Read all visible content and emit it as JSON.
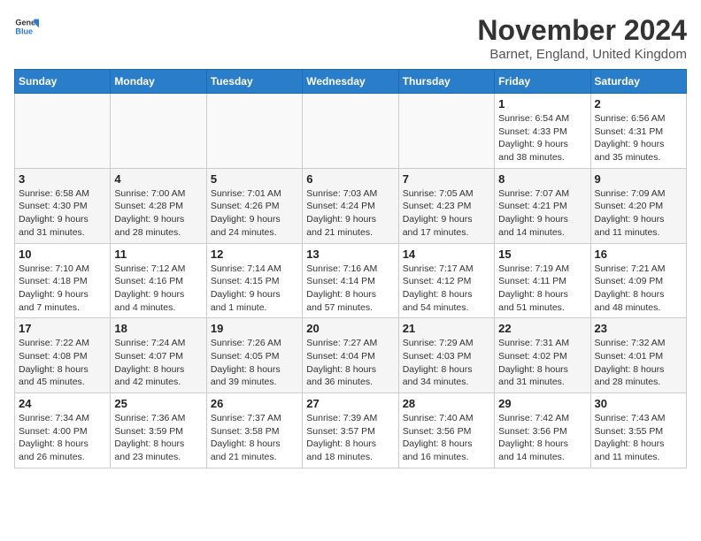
{
  "logo": {
    "text_general": "General",
    "text_blue": "Blue"
  },
  "title": "November 2024",
  "subtitle": "Barnet, England, United Kingdom",
  "days_of_week": [
    "Sunday",
    "Monday",
    "Tuesday",
    "Wednesday",
    "Thursday",
    "Friday",
    "Saturday"
  ],
  "weeks": [
    [
      {
        "day": "",
        "info": ""
      },
      {
        "day": "",
        "info": ""
      },
      {
        "day": "",
        "info": ""
      },
      {
        "day": "",
        "info": ""
      },
      {
        "day": "",
        "info": ""
      },
      {
        "day": "1",
        "info": "Sunrise: 6:54 AM\nSunset: 4:33 PM\nDaylight: 9 hours\nand 38 minutes."
      },
      {
        "day": "2",
        "info": "Sunrise: 6:56 AM\nSunset: 4:31 PM\nDaylight: 9 hours\nand 35 minutes."
      }
    ],
    [
      {
        "day": "3",
        "info": "Sunrise: 6:58 AM\nSunset: 4:30 PM\nDaylight: 9 hours\nand 31 minutes."
      },
      {
        "day": "4",
        "info": "Sunrise: 7:00 AM\nSunset: 4:28 PM\nDaylight: 9 hours\nand 28 minutes."
      },
      {
        "day": "5",
        "info": "Sunrise: 7:01 AM\nSunset: 4:26 PM\nDaylight: 9 hours\nand 24 minutes."
      },
      {
        "day": "6",
        "info": "Sunrise: 7:03 AM\nSunset: 4:24 PM\nDaylight: 9 hours\nand 21 minutes."
      },
      {
        "day": "7",
        "info": "Sunrise: 7:05 AM\nSunset: 4:23 PM\nDaylight: 9 hours\nand 17 minutes."
      },
      {
        "day": "8",
        "info": "Sunrise: 7:07 AM\nSunset: 4:21 PM\nDaylight: 9 hours\nand 14 minutes."
      },
      {
        "day": "9",
        "info": "Sunrise: 7:09 AM\nSunset: 4:20 PM\nDaylight: 9 hours\nand 11 minutes."
      }
    ],
    [
      {
        "day": "10",
        "info": "Sunrise: 7:10 AM\nSunset: 4:18 PM\nDaylight: 9 hours\nand 7 minutes."
      },
      {
        "day": "11",
        "info": "Sunrise: 7:12 AM\nSunset: 4:16 PM\nDaylight: 9 hours\nand 4 minutes."
      },
      {
        "day": "12",
        "info": "Sunrise: 7:14 AM\nSunset: 4:15 PM\nDaylight: 9 hours\nand 1 minute."
      },
      {
        "day": "13",
        "info": "Sunrise: 7:16 AM\nSunset: 4:14 PM\nDaylight: 8 hours\nand 57 minutes."
      },
      {
        "day": "14",
        "info": "Sunrise: 7:17 AM\nSunset: 4:12 PM\nDaylight: 8 hours\nand 54 minutes."
      },
      {
        "day": "15",
        "info": "Sunrise: 7:19 AM\nSunset: 4:11 PM\nDaylight: 8 hours\nand 51 minutes."
      },
      {
        "day": "16",
        "info": "Sunrise: 7:21 AM\nSunset: 4:09 PM\nDaylight: 8 hours\nand 48 minutes."
      }
    ],
    [
      {
        "day": "17",
        "info": "Sunrise: 7:22 AM\nSunset: 4:08 PM\nDaylight: 8 hours\nand 45 minutes."
      },
      {
        "day": "18",
        "info": "Sunrise: 7:24 AM\nSunset: 4:07 PM\nDaylight: 8 hours\nand 42 minutes."
      },
      {
        "day": "19",
        "info": "Sunrise: 7:26 AM\nSunset: 4:05 PM\nDaylight: 8 hours\nand 39 minutes."
      },
      {
        "day": "20",
        "info": "Sunrise: 7:27 AM\nSunset: 4:04 PM\nDaylight: 8 hours\nand 36 minutes."
      },
      {
        "day": "21",
        "info": "Sunrise: 7:29 AM\nSunset: 4:03 PM\nDaylight: 8 hours\nand 34 minutes."
      },
      {
        "day": "22",
        "info": "Sunrise: 7:31 AM\nSunset: 4:02 PM\nDaylight: 8 hours\nand 31 minutes."
      },
      {
        "day": "23",
        "info": "Sunrise: 7:32 AM\nSunset: 4:01 PM\nDaylight: 8 hours\nand 28 minutes."
      }
    ],
    [
      {
        "day": "24",
        "info": "Sunrise: 7:34 AM\nSunset: 4:00 PM\nDaylight: 8 hours\nand 26 minutes."
      },
      {
        "day": "25",
        "info": "Sunrise: 7:36 AM\nSunset: 3:59 PM\nDaylight: 8 hours\nand 23 minutes."
      },
      {
        "day": "26",
        "info": "Sunrise: 7:37 AM\nSunset: 3:58 PM\nDaylight: 8 hours\nand 21 minutes."
      },
      {
        "day": "27",
        "info": "Sunrise: 7:39 AM\nSunset: 3:57 PM\nDaylight: 8 hours\nand 18 minutes."
      },
      {
        "day": "28",
        "info": "Sunrise: 7:40 AM\nSunset: 3:56 PM\nDaylight: 8 hours\nand 16 minutes."
      },
      {
        "day": "29",
        "info": "Sunrise: 7:42 AM\nSunset: 3:56 PM\nDaylight: 8 hours\nand 14 minutes."
      },
      {
        "day": "30",
        "info": "Sunrise: 7:43 AM\nSunset: 3:55 PM\nDaylight: 8 hours\nand 11 minutes."
      }
    ]
  ]
}
